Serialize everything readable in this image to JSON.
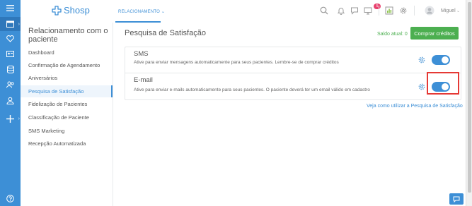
{
  "brand": {
    "name": "Shosp"
  },
  "topbar": {
    "active_tab": "RELACIONAMENTO",
    "notification_count": "5",
    "user_name": "Miguel"
  },
  "rail": {
    "icons": [
      "menu-icon",
      "calendar-icon",
      "heart-icon",
      "id-card-icon",
      "database-icon",
      "users-icon",
      "user-icon",
      "plus-icon",
      "help-icon"
    ]
  },
  "subnav": {
    "title": "Relacionamento com o paciente",
    "items": [
      {
        "label": "Dashboard"
      },
      {
        "label": "Confirmação de Agendamento"
      },
      {
        "label": "Aniversários"
      },
      {
        "label": "Pesquisa de Satisfação",
        "active": true
      },
      {
        "label": "Fidelização de Pacientes"
      },
      {
        "label": "Classificação de Paciente"
      },
      {
        "label": "SMS Marketing"
      },
      {
        "label": "Recepção Automatizada"
      }
    ]
  },
  "main": {
    "title": "Pesquisa de Satisfação",
    "saldo": "Saldo atual: 0",
    "buy_button": "Comprar créditos",
    "rows": [
      {
        "title": "SMS",
        "description": "Ative para enviar mensagens automaticamente para seus pacientes. Lembre-se de comprar créditos",
        "enabled": true
      },
      {
        "title": "E-mail",
        "description": "Ative para enviar e-mails automaticamente para seus pacientes. O paciente deverá ter um email válido em cadastro",
        "enabled": true
      }
    ],
    "help_link": "Veja como utilizar a Pesquisa de Satisfação"
  },
  "colors": {
    "primary": "#3d8fd6",
    "success": "#4caf50",
    "highlight": "#e53935",
    "badge": "#e8416e"
  }
}
